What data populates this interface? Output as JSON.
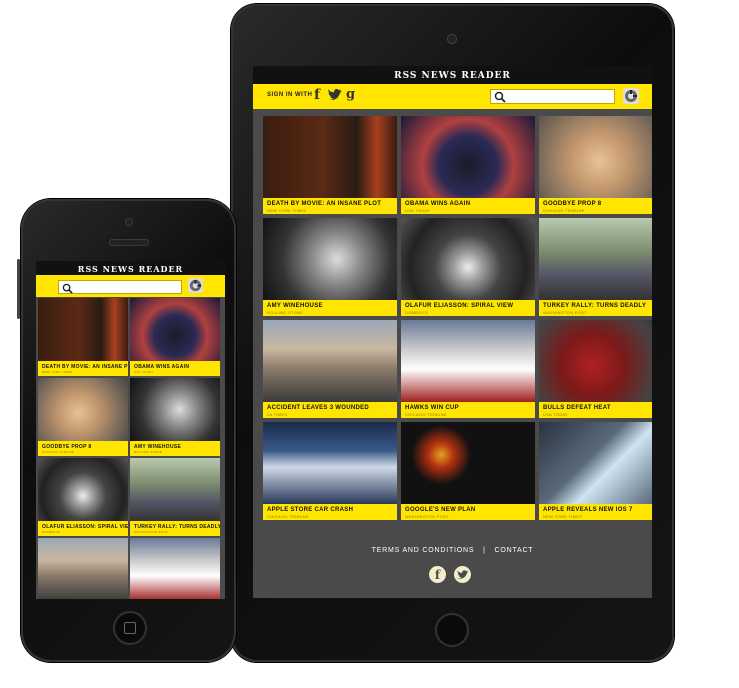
{
  "app": {
    "title": "RSS NEWS READER"
  },
  "header": {
    "sign_in_label": "SIGN IN WITH",
    "icons": [
      "facebook-icon",
      "twitter-icon",
      "google-icon",
      "search-icon"
    ]
  },
  "articles": [
    {
      "title": "DEATH BY MOVIE: AN INSANE PLOT",
      "source": "NEW YORK TIMES"
    },
    {
      "title": "OBAMA WINS AGAIN",
      "source": "USA TODAY"
    },
    {
      "title": "GOODBYE PROP 8",
      "source": "CHICAGO TRIBUNE"
    },
    {
      "title": "AMY WINEHOUSE",
      "source": "ROLLING STONE"
    },
    {
      "title": "OLAFUR ELIASSON: SPIRAL VIEW",
      "source": "DOMBSITE"
    },
    {
      "title": "TURKEY RALLY: TURNS DEADLY",
      "source": "WASHINGTON POST"
    },
    {
      "title": "ACCIDENT LEAVES 3 WOUNDED",
      "source": "LA TIMES"
    },
    {
      "title": "HAWKS WIN CUP",
      "source": "CHICAGO TRIBUNE"
    },
    {
      "title": "BULLS DEFEAT HEAT",
      "source": "USA TODAY"
    },
    {
      "title": "APPLE STORE CAR CRASH",
      "source": "CHICAGO TRIBUNE"
    },
    {
      "title": "GOOGLE'S NEW PLAN",
      "source": "WASHINGTON POST"
    },
    {
      "title": "APPLE REVEALS NEW IOS 7",
      "source": "NEW YORK TIMES"
    }
  ],
  "footer": {
    "terms": "TERMS AND CONDITIONS",
    "separator": "|",
    "contact": "CONTACT"
  },
  "colors": {
    "accent": "#ffe500",
    "title_bar": "#111111",
    "footer": "#4a4a4a"
  }
}
